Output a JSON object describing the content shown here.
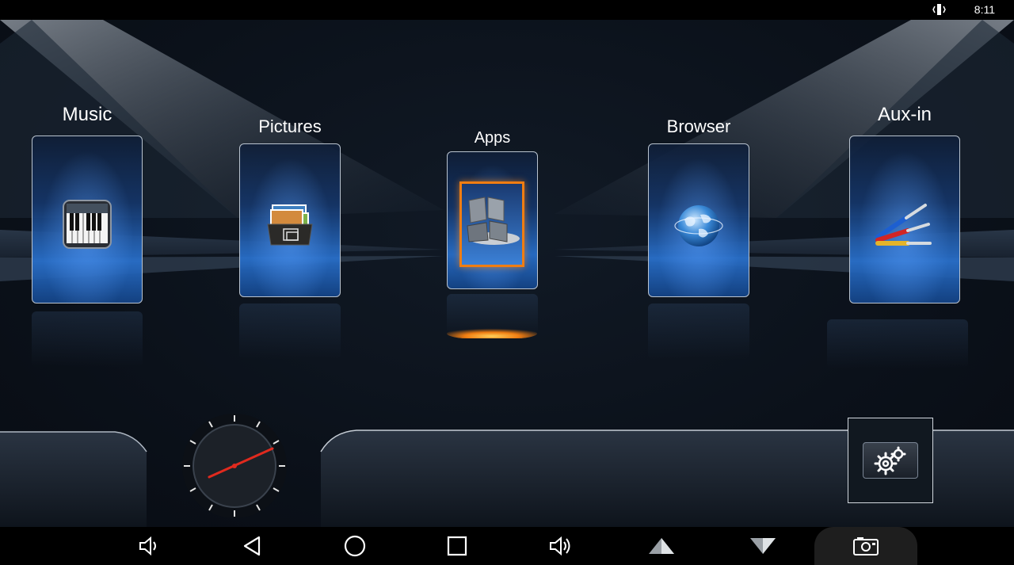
{
  "status_bar": {
    "time": "8:11",
    "signal_icon": "vibrate-icon"
  },
  "tiles": [
    {
      "label": "Music",
      "icon": "piano-icon"
    },
    {
      "label": "Pictures",
      "icon": "photo-folder-icon"
    },
    {
      "label": "Apps",
      "icon": "apps-icon",
      "selected": true
    },
    {
      "label": "Browser",
      "icon": "globe-icon"
    },
    {
      "label": "Aux-in",
      "icon": "audio-jack-icon"
    }
  ],
  "dock": {
    "gauge_icon": "clock-gauge-icon",
    "settings_icon": "gears-icon"
  },
  "nav_bar": {
    "buttons": [
      "volume-down-icon",
      "back-icon",
      "home-icon",
      "recents-icon",
      "volume-up-icon",
      "up-arrow-icon",
      "down-arrow-icon",
      "screenshot-icon"
    ]
  },
  "colors": {
    "accent_orange": "#f07d12",
    "glow_blue": "#3b80d6"
  }
}
